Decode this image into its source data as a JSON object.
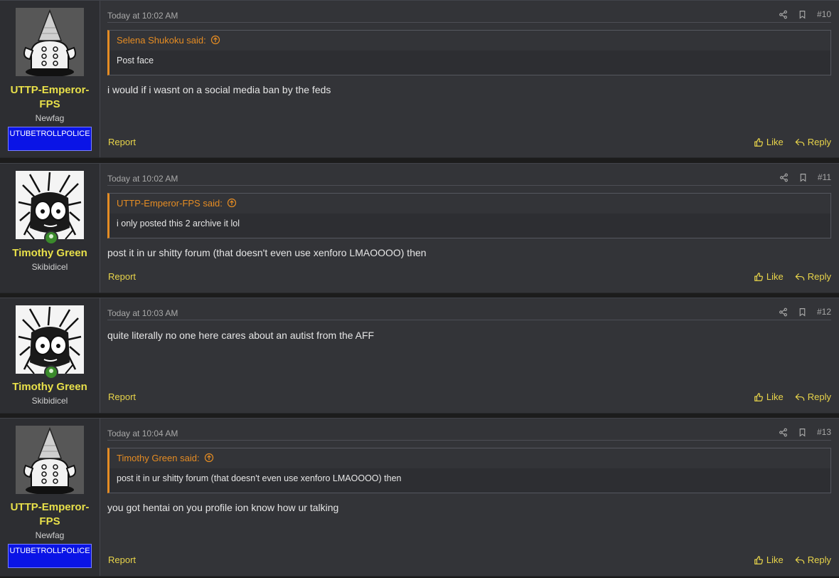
{
  "posts": [
    {
      "user": {
        "name": "UTTP-Emperor-FPS",
        "title": "Newfag",
        "banner": "UTUBETROLLPOLICE"
      },
      "date": "Today at 10:02 AM",
      "number": "#10",
      "quote": {
        "author_line": "Selena Shukoku said:",
        "text": "Post face"
      },
      "message": "i would if i wasnt on a social media ban by the feds",
      "report": "Report",
      "like": "Like",
      "reply": "Reply"
    },
    {
      "user": {
        "name": "Timothy Green",
        "title": "Skibidicel"
      },
      "date": "Today at 10:02 AM",
      "number": "#11",
      "quote": {
        "author_line": "UTTP-Emperor-FPS said:",
        "text": "i only posted this 2 archive it lol"
      },
      "message": "post it in ur shitty forum (that doesn't even use xenforo LMAOOOO) then",
      "report": "Report",
      "like": "Like",
      "reply": "Reply"
    },
    {
      "user": {
        "name": "Timothy Green",
        "title": "Skibidicel"
      },
      "date": "Today at 10:03 AM",
      "number": "#12",
      "message": "quite literally no one here cares about an autist from the AFF",
      "report": "Report",
      "like": "Like",
      "reply": "Reply"
    },
    {
      "user": {
        "name": "UTTP-Emperor-FPS",
        "title": "Newfag",
        "banner": "UTUBETROLLPOLICE"
      },
      "date": "Today at 10:04 AM",
      "number": "#13",
      "quote": {
        "author_line": "Timothy Green said:",
        "text": "post it in ur shitty forum (that doesn't even use xenforo LMAOOOO) then"
      },
      "message": "you got hentai on you profile ion know how ur talking",
      "report": "Report",
      "like": "Like",
      "reply": "Reply"
    }
  ],
  "icons": {
    "share": "share-icon",
    "bookmark": "bookmark-icon",
    "like": "thumbs-up-icon",
    "reply": "reply-icon",
    "jump": "arrow-circle-up-icon",
    "online": "online-status-icon"
  },
  "colors": {
    "username": "#e8e04a",
    "quote_accent": "#e58c23",
    "link": "#e8d44a",
    "banner_bg": "#0a14e6",
    "online": "#3a8a2b"
  }
}
